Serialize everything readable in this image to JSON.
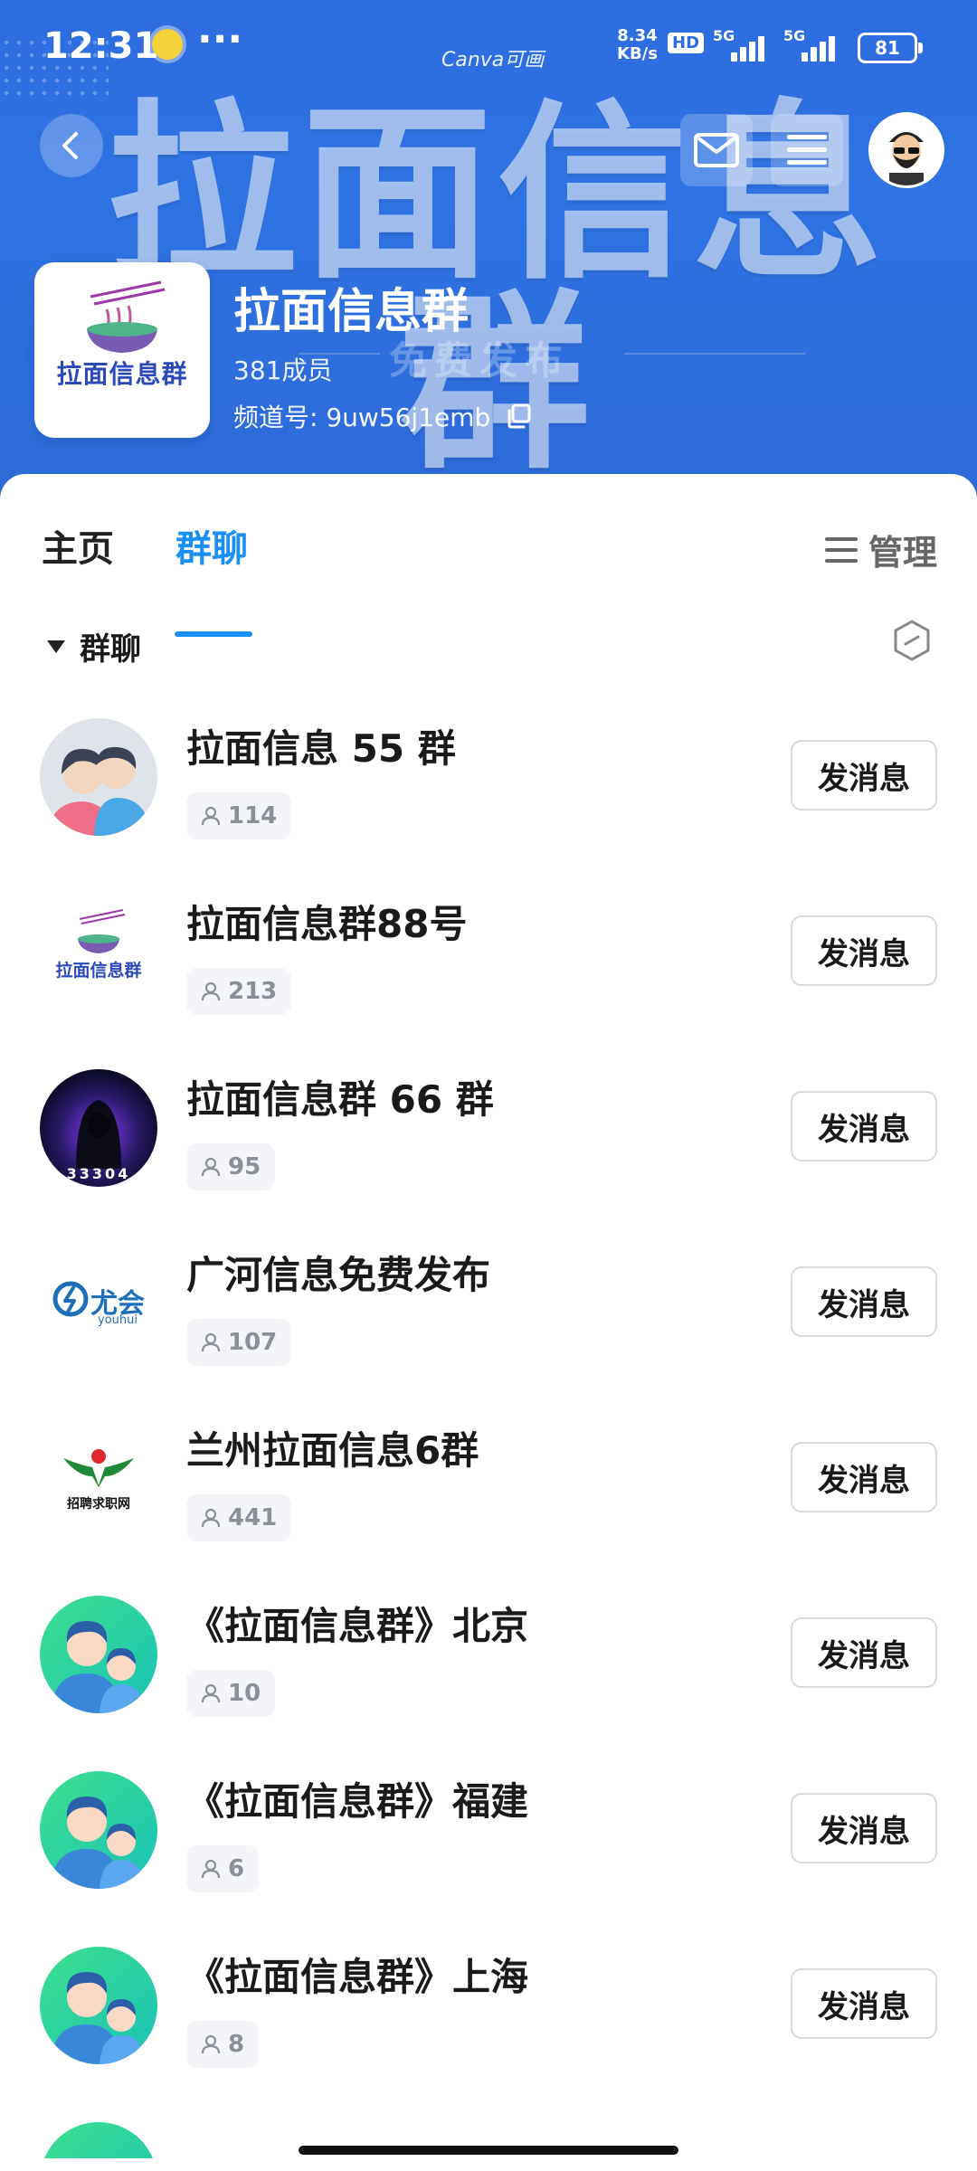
{
  "status_bar": {
    "time": "12:31",
    "more": "···",
    "canva": "Canva可画",
    "net_speed": "8.34",
    "net_unit": "KB/s",
    "hd": "HD",
    "sig1": "5G",
    "sig2": "5G",
    "battery": "81"
  },
  "banner": {
    "big_title": "拉面信息群",
    "subtitle": "免费发布"
  },
  "channel": {
    "logo_text": "拉面信息群",
    "name": "拉面信息群",
    "members": "381成员",
    "id_label": "频道号: 9uw56j1emb"
  },
  "tabs": {
    "home": "主页",
    "group": "群聊",
    "manage": "管理"
  },
  "section": {
    "title": "群聊"
  },
  "groups": [
    {
      "title": "拉面信息 55 群",
      "count": "114",
      "button": "发消息"
    },
    {
      "title": "拉面信息群88号",
      "count": "213",
      "button": "发消息"
    },
    {
      "title": "拉面信息群 66 群",
      "count": "95",
      "button": "发消息"
    },
    {
      "title": "广河信息免费发布",
      "count": "107",
      "button": "发消息"
    },
    {
      "title": "兰州拉面信息6群",
      "count": "441",
      "button": "发消息"
    },
    {
      "title": "《拉面信息群》北京",
      "count": "10",
      "button": "发消息"
    },
    {
      "title": "《拉面信息群》福建",
      "count": "6",
      "button": "发消息"
    },
    {
      "title": "《拉面信息群》上海",
      "count": "8",
      "button": "发消息"
    }
  ],
  "avatar_labels": {
    "row2": "拉面信息群",
    "row3": "33304",
    "row4_brand": "尤会",
    "row4_sub": "youhui",
    "row5": "招聘求职网"
  },
  "colors": {
    "accent": "#1a8ff5",
    "banner": "#2d6cdf"
  }
}
